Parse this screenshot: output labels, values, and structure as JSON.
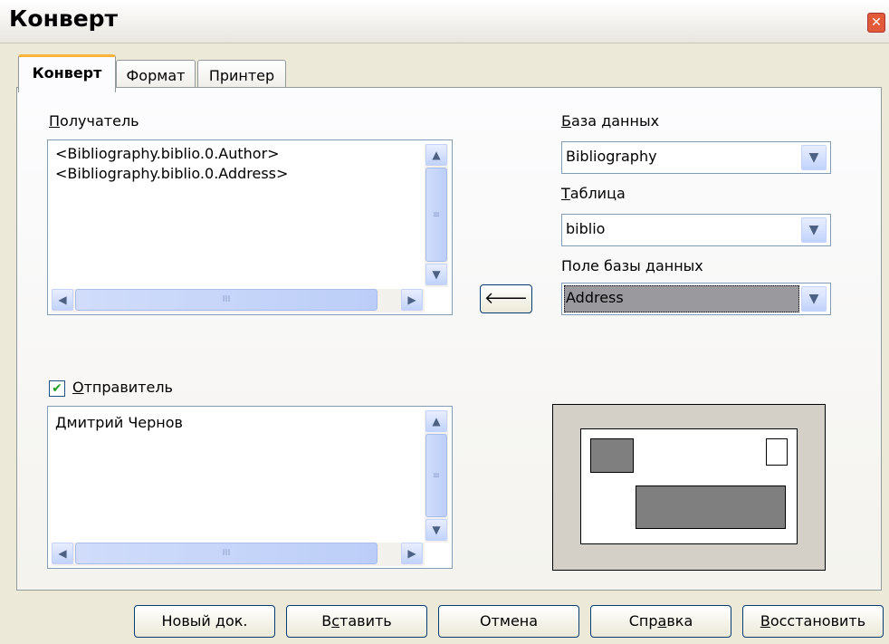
{
  "window": {
    "title": "Конверт",
    "close_glyph": "✕"
  },
  "tabs": [
    {
      "label": "Конверт",
      "active": true
    },
    {
      "label": "Формат",
      "active": false
    },
    {
      "label": "Принтер",
      "active": false
    }
  ],
  "recipient": {
    "label_first": "П",
    "label_rest": "олучатель",
    "lines": [
      "<Bibliography.biblio.0.Author>",
      "<Bibliography.biblio.0.Address>"
    ]
  },
  "insert_arrow_glyph": "🡐",
  "database": {
    "label_first": "Б",
    "label_rest": "аза данных",
    "value": "Bibliography"
  },
  "table": {
    "label_first": "Т",
    "label_rest": "аблица",
    "value": "biblio"
  },
  "db_field": {
    "label_start": "Поле базы ",
    "label_first": "д",
    "label_rest": "анных",
    "value": "Address"
  },
  "sender": {
    "checked": true,
    "check_glyph": "✔",
    "label_first": "О",
    "label_rest": "тправитель",
    "text": "Дмитрий Чернов"
  },
  "scroll_glyphs": {
    "up": "▲",
    "down": "▼",
    "left": "◀",
    "right": "▶",
    "grip_v": "≡",
    "grip_h": "III"
  },
  "buttons": {
    "new_doc": "Новый док.",
    "insert_pre": "В",
    "insert_u": "с",
    "insert_post": "тавить",
    "cancel": "Отмена",
    "help_pre": "Спр",
    "help_u": "а",
    "help_post": "вка",
    "reset_u": "В",
    "reset_post": "осстановить"
  },
  "colors": {
    "dialog_bg": "#ece9d8",
    "tab_highlight": "#f8b43a",
    "preview_fill": "#7f7f7f",
    "selected_combo": "#9a9a9e"
  }
}
